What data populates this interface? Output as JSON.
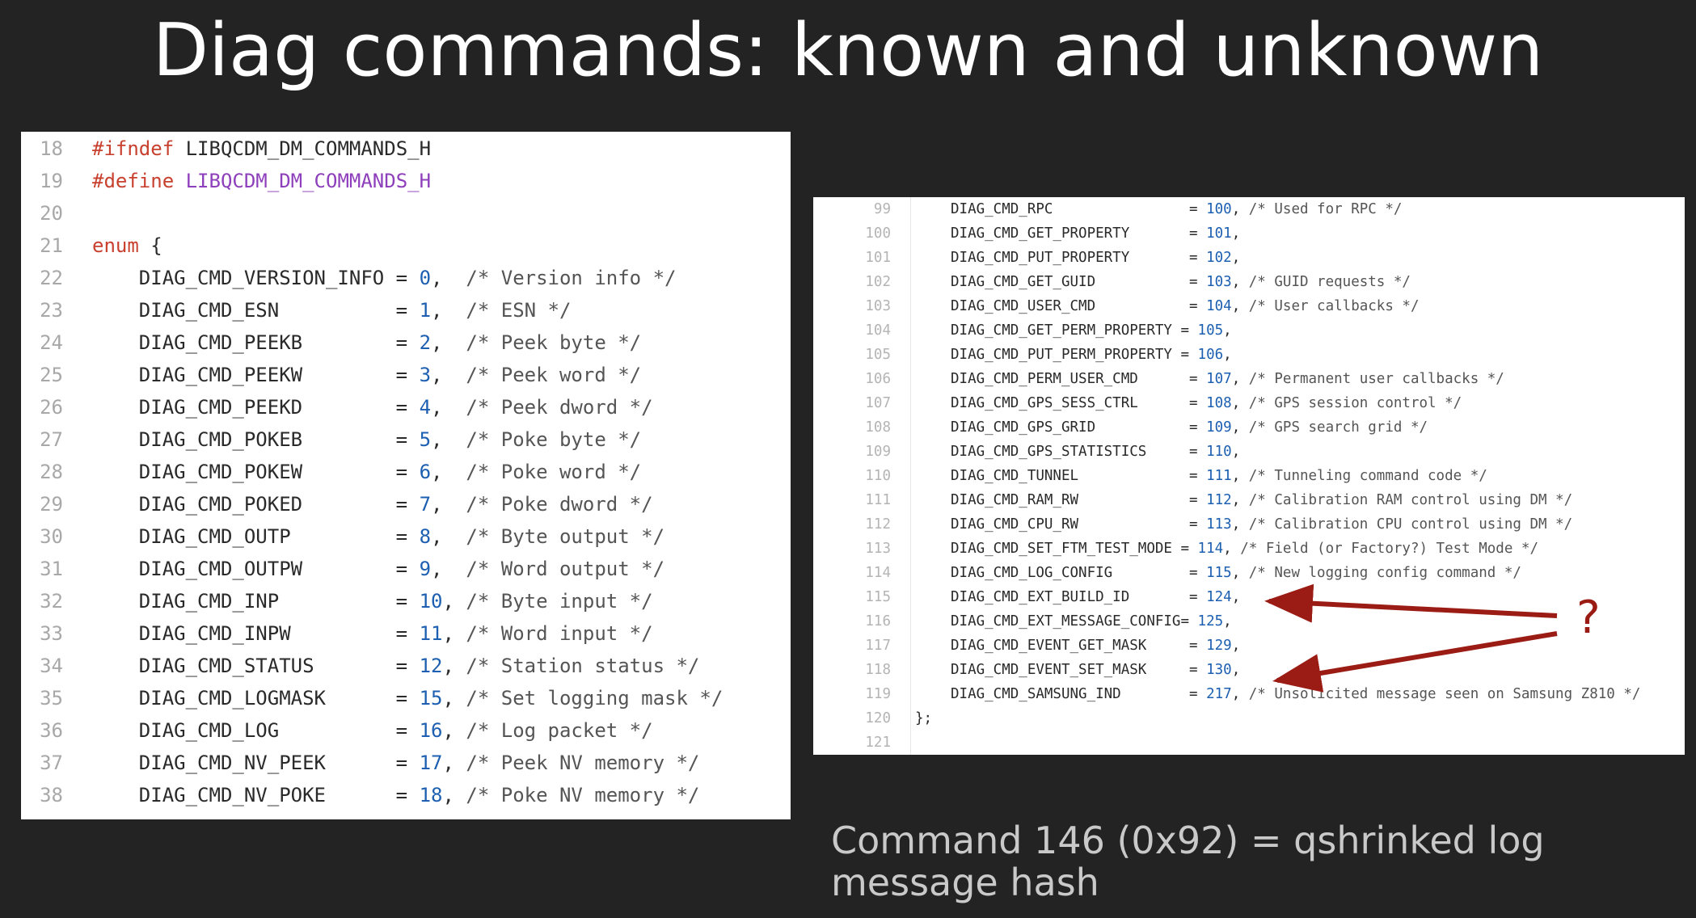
{
  "slide": {
    "title": "Diag commands: known and unknown",
    "note": "Command 146 (0x92) = qshrinked log message hash",
    "question_mark": "?"
  },
  "colors": {
    "background": "#232323",
    "keyword": "#c8402e",
    "macro": "#8e3fbb",
    "number": "#1d5fb0",
    "arrow": "#9b1c14"
  },
  "left_code": [
    {
      "ln": "18",
      "parts": [
        {
          "c": "kw",
          "t": "#ifndef"
        },
        {
          "t": " LIBQCDM_DM_COMMANDS_H"
        }
      ]
    },
    {
      "ln": "19",
      "parts": [
        {
          "c": "kw",
          "t": "#define"
        },
        {
          "t": " "
        },
        {
          "c": "mac",
          "t": "LIBQCDM_DM_COMMANDS_H"
        }
      ]
    },
    {
      "ln": "20",
      "parts": []
    },
    {
      "ln": "21",
      "parts": [
        {
          "c": "kw",
          "t": "enum"
        },
        {
          "t": " {"
        }
      ]
    },
    {
      "ln": "22",
      "parts": [
        {
          "t": "    DIAG_CMD_VERSION_INFO = "
        },
        {
          "c": "num",
          "t": "0"
        },
        {
          "t": ",  "
        },
        {
          "c": "cmt",
          "t": "/* Version info */"
        }
      ]
    },
    {
      "ln": "23",
      "parts": [
        {
          "t": "    DIAG_CMD_ESN          = "
        },
        {
          "c": "num",
          "t": "1"
        },
        {
          "t": ",  "
        },
        {
          "c": "cmt",
          "t": "/* ESN */"
        }
      ]
    },
    {
      "ln": "24",
      "parts": [
        {
          "t": "    DIAG_CMD_PEEKB        = "
        },
        {
          "c": "num",
          "t": "2"
        },
        {
          "t": ",  "
        },
        {
          "c": "cmt",
          "t": "/* Peek byte */"
        }
      ]
    },
    {
      "ln": "25",
      "parts": [
        {
          "t": "    DIAG_CMD_PEEKW        = "
        },
        {
          "c": "num",
          "t": "3"
        },
        {
          "t": ",  "
        },
        {
          "c": "cmt",
          "t": "/* Peek word */"
        }
      ]
    },
    {
      "ln": "26",
      "parts": [
        {
          "t": "    DIAG_CMD_PEEKD        = "
        },
        {
          "c": "num",
          "t": "4"
        },
        {
          "t": ",  "
        },
        {
          "c": "cmt",
          "t": "/* Peek dword */"
        }
      ]
    },
    {
      "ln": "27",
      "parts": [
        {
          "t": "    DIAG_CMD_POKEB        = "
        },
        {
          "c": "num",
          "t": "5"
        },
        {
          "t": ",  "
        },
        {
          "c": "cmt",
          "t": "/* Poke byte */"
        }
      ]
    },
    {
      "ln": "28",
      "parts": [
        {
          "t": "    DIAG_CMD_POKEW        = "
        },
        {
          "c": "num",
          "t": "6"
        },
        {
          "t": ",  "
        },
        {
          "c": "cmt",
          "t": "/* Poke word */"
        }
      ]
    },
    {
      "ln": "29",
      "parts": [
        {
          "t": "    DIAG_CMD_POKED        = "
        },
        {
          "c": "num",
          "t": "7"
        },
        {
          "t": ",  "
        },
        {
          "c": "cmt",
          "t": "/* Poke dword */"
        }
      ]
    },
    {
      "ln": "30",
      "parts": [
        {
          "t": "    DIAG_CMD_OUTP         = "
        },
        {
          "c": "num",
          "t": "8"
        },
        {
          "t": ",  "
        },
        {
          "c": "cmt",
          "t": "/* Byte output */"
        }
      ]
    },
    {
      "ln": "31",
      "parts": [
        {
          "t": "    DIAG_CMD_OUTPW        = "
        },
        {
          "c": "num",
          "t": "9"
        },
        {
          "t": ",  "
        },
        {
          "c": "cmt",
          "t": "/* Word output */"
        }
      ]
    },
    {
      "ln": "32",
      "parts": [
        {
          "t": "    DIAG_CMD_INP          = "
        },
        {
          "c": "num",
          "t": "10"
        },
        {
          "t": ", "
        },
        {
          "c": "cmt",
          "t": "/* Byte input */"
        }
      ]
    },
    {
      "ln": "33",
      "parts": [
        {
          "t": "    DIAG_CMD_INPW         = "
        },
        {
          "c": "num",
          "t": "11"
        },
        {
          "t": ", "
        },
        {
          "c": "cmt",
          "t": "/* Word input */"
        }
      ]
    },
    {
      "ln": "34",
      "parts": [
        {
          "t": "    DIAG_CMD_STATUS       = "
        },
        {
          "c": "num",
          "t": "12"
        },
        {
          "t": ", "
        },
        {
          "c": "cmt",
          "t": "/* Station status */"
        }
      ]
    },
    {
      "ln": "35",
      "parts": [
        {
          "t": "    DIAG_CMD_LOGMASK      = "
        },
        {
          "c": "num",
          "t": "15"
        },
        {
          "t": ", "
        },
        {
          "c": "cmt",
          "t": "/* Set logging mask */"
        }
      ]
    },
    {
      "ln": "36",
      "parts": [
        {
          "t": "    DIAG_CMD_LOG          = "
        },
        {
          "c": "num",
          "t": "16"
        },
        {
          "t": ", "
        },
        {
          "c": "cmt",
          "t": "/* Log packet */"
        }
      ]
    },
    {
      "ln": "37",
      "parts": [
        {
          "t": "    DIAG_CMD_NV_PEEK      = "
        },
        {
          "c": "num",
          "t": "17"
        },
        {
          "t": ", "
        },
        {
          "c": "cmt",
          "t": "/* Peek NV memory */"
        }
      ]
    },
    {
      "ln": "38",
      "parts": [
        {
          "t": "    DIAG_CMD_NV_POKE      = "
        },
        {
          "c": "num",
          "t": "18"
        },
        {
          "t": ", "
        },
        {
          "c": "cmt",
          "t": "/* Poke NV memory */"
        }
      ]
    }
  ],
  "right_code": [
    {
      "ln": "99",
      "parts": [
        {
          "t": "DIAG_CMD_RPC                = "
        },
        {
          "c": "num",
          "t": "100"
        },
        {
          "t": ", "
        },
        {
          "c": "cmt",
          "t": "/* Used for RPC */"
        }
      ]
    },
    {
      "ln": "100",
      "parts": [
        {
          "t": "DIAG_CMD_GET_PROPERTY       = "
        },
        {
          "c": "num",
          "t": "101"
        },
        {
          "t": ","
        }
      ]
    },
    {
      "ln": "101",
      "parts": [
        {
          "t": "DIAG_CMD_PUT_PROPERTY       = "
        },
        {
          "c": "num",
          "t": "102"
        },
        {
          "t": ","
        }
      ]
    },
    {
      "ln": "102",
      "parts": [
        {
          "t": "DIAG_CMD_GET_GUID           = "
        },
        {
          "c": "num",
          "t": "103"
        },
        {
          "t": ", "
        },
        {
          "c": "cmt",
          "t": "/* GUID requests */"
        }
      ]
    },
    {
      "ln": "103",
      "parts": [
        {
          "t": "DIAG_CMD_USER_CMD           = "
        },
        {
          "c": "num",
          "t": "104"
        },
        {
          "t": ", "
        },
        {
          "c": "cmt",
          "t": "/* User callbacks */"
        }
      ]
    },
    {
      "ln": "104",
      "parts": [
        {
          "t": "DIAG_CMD_GET_PERM_PROPERTY = "
        },
        {
          "c": "num",
          "t": "105"
        },
        {
          "t": ","
        }
      ]
    },
    {
      "ln": "105",
      "parts": [
        {
          "t": "DIAG_CMD_PUT_PERM_PROPERTY = "
        },
        {
          "c": "num",
          "t": "106"
        },
        {
          "t": ","
        }
      ]
    },
    {
      "ln": "106",
      "parts": [
        {
          "t": "DIAG_CMD_PERM_USER_CMD      = "
        },
        {
          "c": "num",
          "t": "107"
        },
        {
          "t": ", "
        },
        {
          "c": "cmt",
          "t": "/* Permanent user callbacks */"
        }
      ]
    },
    {
      "ln": "107",
      "parts": [
        {
          "t": "DIAG_CMD_GPS_SESS_CTRL      = "
        },
        {
          "c": "num",
          "t": "108"
        },
        {
          "t": ", "
        },
        {
          "c": "cmt",
          "t": "/* GPS session control */"
        }
      ]
    },
    {
      "ln": "108",
      "parts": [
        {
          "t": "DIAG_CMD_GPS_GRID           = "
        },
        {
          "c": "num",
          "t": "109"
        },
        {
          "t": ", "
        },
        {
          "c": "cmt",
          "t": "/* GPS search grid */"
        }
      ]
    },
    {
      "ln": "109",
      "parts": [
        {
          "t": "DIAG_CMD_GPS_STATISTICS     = "
        },
        {
          "c": "num",
          "t": "110"
        },
        {
          "t": ","
        }
      ]
    },
    {
      "ln": "110",
      "parts": [
        {
          "t": "DIAG_CMD_TUNNEL             = "
        },
        {
          "c": "num",
          "t": "111"
        },
        {
          "t": ", "
        },
        {
          "c": "cmt",
          "t": "/* Tunneling command code */"
        }
      ]
    },
    {
      "ln": "111",
      "parts": [
        {
          "t": "DIAG_CMD_RAM_RW             = "
        },
        {
          "c": "num",
          "t": "112"
        },
        {
          "t": ", "
        },
        {
          "c": "cmt",
          "t": "/* Calibration RAM control using DM */"
        }
      ]
    },
    {
      "ln": "112",
      "parts": [
        {
          "t": "DIAG_CMD_CPU_RW             = "
        },
        {
          "c": "num",
          "t": "113"
        },
        {
          "t": ", "
        },
        {
          "c": "cmt",
          "t": "/* Calibration CPU control using DM */"
        }
      ]
    },
    {
      "ln": "113",
      "parts": [
        {
          "t": "DIAG_CMD_SET_FTM_TEST_MODE = "
        },
        {
          "c": "num",
          "t": "114"
        },
        {
          "t": ", "
        },
        {
          "c": "cmt",
          "t": "/* Field (or Factory?) Test Mode */"
        }
      ]
    },
    {
      "ln": "114",
      "parts": [
        {
          "t": "DIAG_CMD_LOG_CONFIG         = "
        },
        {
          "c": "num",
          "t": "115"
        },
        {
          "t": ", "
        },
        {
          "c": "cmt",
          "t": "/* New logging config command */"
        }
      ]
    },
    {
      "ln": "115",
      "parts": [
        {
          "t": "DIAG_CMD_EXT_BUILD_ID       = "
        },
        {
          "c": "num",
          "t": "124"
        },
        {
          "t": ","
        }
      ]
    },
    {
      "ln": "116",
      "parts": [
        {
          "t": "DIAG_CMD_EXT_MESSAGE_CONFIG= "
        },
        {
          "c": "num",
          "t": "125"
        },
        {
          "t": ","
        }
      ]
    },
    {
      "ln": "117",
      "parts": [
        {
          "t": "DIAG_CMD_EVENT_GET_MASK     = "
        },
        {
          "c": "num",
          "t": "129"
        },
        {
          "t": ","
        }
      ]
    },
    {
      "ln": "118",
      "parts": [
        {
          "t": "DIAG_CMD_EVENT_SET_MASK     = "
        },
        {
          "c": "num",
          "t": "130"
        },
        {
          "t": ","
        }
      ]
    },
    {
      "ln": "119",
      "parts": [
        {
          "t": "DIAG_CMD_SAMSUNG_IND        = "
        },
        {
          "c": "num",
          "t": "217"
        },
        {
          "t": ", "
        },
        {
          "c": "cmt",
          "t": "/* Unsolicited message seen on Samsung Z810 */"
        }
      ]
    },
    {
      "ln": "120",
      "parts": [
        {
          "t": "};"
        }
      ],
      "indent": "outer"
    },
    {
      "ln": "121",
      "parts": []
    }
  ]
}
